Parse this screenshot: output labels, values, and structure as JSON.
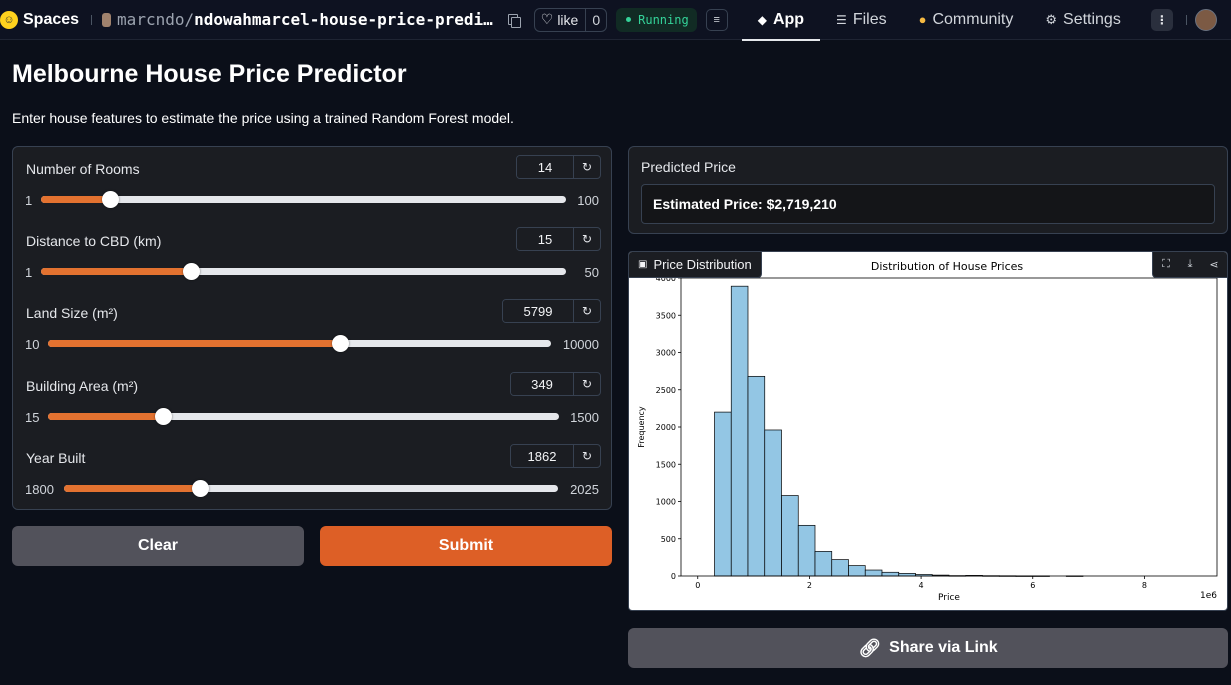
{
  "topbar": {
    "brand": "Spaces",
    "owner": "marcndo",
    "repo": "ndowahmarcel-house-price-predi…",
    "like_label": "like",
    "like_count": "0",
    "status": "Running",
    "nav": [
      {
        "label": "App",
        "icon": "cube-icon",
        "active": true
      },
      {
        "label": "Files",
        "icon": "files-icon",
        "active": false
      },
      {
        "label": "Community",
        "icon": "community-icon",
        "active": false
      },
      {
        "label": "Settings",
        "icon": "gear-icon",
        "active": false
      }
    ]
  },
  "page": {
    "title": "Melbourne House Price Predictor",
    "description": "Enter house features to estimate the price using a trained Random Forest model."
  },
  "sliders": [
    {
      "label": "Number of Rooms",
      "value": "14",
      "min": "1",
      "max": "100",
      "fraction": 0.131
    },
    {
      "label": "Distance to CBD (km)",
      "value": "15",
      "min": "1",
      "max": "50",
      "fraction": 0.286
    },
    {
      "label": "Land Size (m²)",
      "value": "5799",
      "min": "10",
      "max": "10000",
      "fraction": 0.58
    },
    {
      "label": "Building Area (m²)",
      "value": "349",
      "min": "15",
      "max": "1500",
      "fraction": 0.225
    },
    {
      "label": "Year Built",
      "value": "1862",
      "min": "1800",
      "max": "2025",
      "fraction": 0.276
    }
  ],
  "buttons": {
    "clear": "Clear",
    "submit": "Submit",
    "share": "Share via Link"
  },
  "output": {
    "label": "Predicted Price",
    "value": "Estimated Price: $2,719,210"
  },
  "plot_tab": "Price Distribution",
  "colors": {
    "accent": "#e37230",
    "submit": "#dd5f26",
    "bar": "#93c6e4",
    "running": "#34d399"
  },
  "chart_data": {
    "type": "bar",
    "title": "Distribution of House Prices",
    "xlabel": "Price",
    "ylabel": "Frequency",
    "x_offset_label": "1e6",
    "xlim": [
      -0.3,
      9.3
    ],
    "ylim": [
      0,
      4000
    ],
    "xticks": [
      0,
      2,
      4,
      6,
      8
    ],
    "yticks": [
      0,
      500,
      1000,
      1500,
      2000,
      2500,
      3000,
      3500,
      4000
    ],
    "bin_width": 0.3,
    "bin_starts": [
      0.3,
      0.6,
      0.9,
      1.2,
      1.5,
      1.8,
      2.1,
      2.4,
      2.7,
      3.0,
      3.3,
      3.6,
      3.9,
      4.2,
      4.5,
      4.8,
      5.1,
      5.4,
      5.7,
      6.0,
      6.3,
      6.6,
      6.9,
      7.2,
      7.5,
      7.8,
      8.1,
      8.4,
      8.7,
      9.0
    ],
    "values": [
      2200,
      3890,
      2680,
      1960,
      1080,
      680,
      330,
      220,
      140,
      80,
      50,
      35,
      20,
      12,
      5,
      8,
      4,
      3,
      2,
      2,
      0,
      2,
      0,
      0,
      0,
      0,
      0,
      0,
      0,
      0
    ],
    "bar_color": "#93c6e4",
    "edge_color": "#000000"
  }
}
